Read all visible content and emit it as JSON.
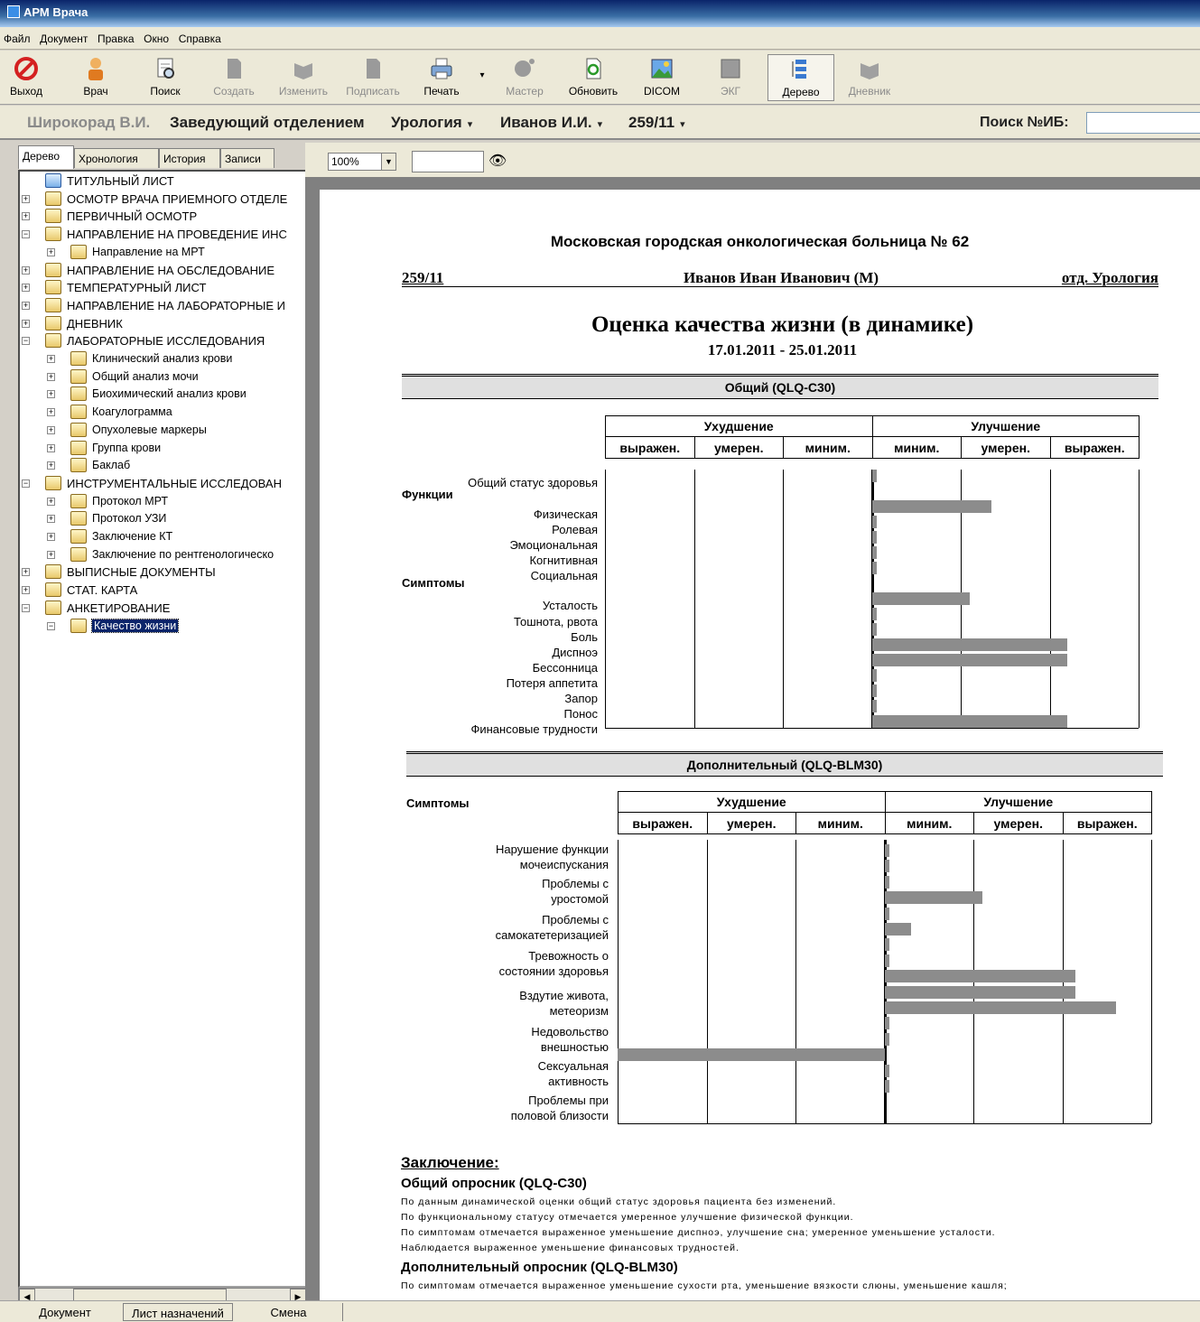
{
  "window": {
    "title": "АРМ Врача"
  },
  "menu": [
    "Файл",
    "Документ",
    "Правка",
    "Окно",
    "Справка"
  ],
  "toolbar": {
    "exit": "Выход",
    "doctor": "Врач",
    "search": "Поиск",
    "create": "Создать",
    "edit": "Изменить",
    "sign": "Подписать",
    "print": "Печать",
    "wizard": "Мастер",
    "refresh": "Обновить",
    "dicom": "DICOM",
    "ecg": "ЭКГ",
    "tree": "Дерево",
    "diary": "Дневник"
  },
  "context": {
    "doctor": "Широкорад В.И.",
    "position": "Заведующий отделением",
    "department": "Урология",
    "patient": "Иванов И.И.",
    "case": "259/11",
    "search_label": "Поиск №ИБ:",
    "search_value": ""
  },
  "left_tabs": [
    "Дерево",
    "Хронология",
    "История",
    "Записи"
  ],
  "tree": [
    {
      "label": "ТИТУЛЬНЫЙ ЛИСТ",
      "level": 0,
      "toggle": ""
    },
    {
      "label": "ОСМОТР ВРАЧА ПРИЕМНОГО ОТДЕЛЕ",
      "level": 0,
      "toggle": "+"
    },
    {
      "label": "ПЕРВИЧНЫЙ ОСМОТР",
      "level": 0,
      "toggle": "+"
    },
    {
      "label": "НАПРАВЛЕНИЕ НА ПРОВЕДЕНИЕ ИНС",
      "level": 0,
      "toggle": "−"
    },
    {
      "label": "Направление на МРТ",
      "level": 1,
      "toggle": "+"
    },
    {
      "label": "НАПРАВЛЕНИЕ НА ОБСЛЕДОВАНИЕ",
      "level": 0,
      "toggle": "+"
    },
    {
      "label": "ТЕМПЕРАТУРНЫЙ ЛИСТ",
      "level": 0,
      "toggle": "+"
    },
    {
      "label": "НАПРАВЛЕНИЕ НА ЛАБОРАТОРНЫЕ И",
      "level": 0,
      "toggle": "+"
    },
    {
      "label": "ДНЕВНИК",
      "level": 0,
      "toggle": "+"
    },
    {
      "label": "ЛАБОРАТОРНЫЕ ИССЛЕДОВАНИЯ",
      "level": 0,
      "toggle": "−"
    },
    {
      "label": "Клинический анализ крови",
      "level": 1,
      "toggle": "+"
    },
    {
      "label": "Общий анализ мочи",
      "level": 1,
      "toggle": "+"
    },
    {
      "label": "Биохимический анализ крови",
      "level": 1,
      "toggle": "+"
    },
    {
      "label": "Коагулограмма",
      "level": 1,
      "toggle": "+"
    },
    {
      "label": "Опухолевые маркеры",
      "level": 1,
      "toggle": "+"
    },
    {
      "label": "Группа крови",
      "level": 1,
      "toggle": "+"
    },
    {
      "label": "Баклаб",
      "level": 1,
      "toggle": "+"
    },
    {
      "label": "ИНСТРУМЕНТАЛЬНЫЕ ИССЛЕДОВАН",
      "level": 0,
      "toggle": "−"
    },
    {
      "label": "Протокол МРТ",
      "level": 1,
      "toggle": "+"
    },
    {
      "label": "Протокол УЗИ",
      "level": 1,
      "toggle": "+"
    },
    {
      "label": "Заключение КТ",
      "level": 1,
      "toggle": "+"
    },
    {
      "label": "Заключение по рентгенологическо",
      "level": 1,
      "toggle": "+"
    },
    {
      "label": "ВЫПИСНЫЕ ДОКУМЕНТЫ",
      "level": 0,
      "toggle": "+"
    },
    {
      "label": "СТАТ. КАРТА",
      "level": 0,
      "toggle": "+"
    },
    {
      "label": "АНКЕТИРОВАНИЕ",
      "level": 0,
      "toggle": "−"
    },
    {
      "label": "Качество жизни",
      "level": 1,
      "toggle": "−",
      "selected": true
    }
  ],
  "viewer": {
    "zoom": "100%",
    "find_value": ""
  },
  "report": {
    "hospital": "Московская городская онкологическая больница №     62",
    "case_no": "259/11",
    "patient_full": "Иванов Иван Иванович (М)",
    "department": "отд. Урология",
    "title": "Оценка качества жизни (в динамике)",
    "dates": "17.01.2011 - 25.01.2011",
    "worse": "Ухудшение",
    "better": "Улучшение",
    "cols_worse": [
      "выражен.",
      "умерен.",
      "миним."
    ],
    "cols_better": [
      "миним.",
      "умерен.",
      "выражен."
    ],
    "sec1": {
      "title": "Общий (QLQ-C30)",
      "groups": [
        "Функции",
        "Симптомы"
      ],
      "rows": [
        "Общий статус здоровья",
        "Физическая",
        "Ролевая",
        "Эмоциональная",
        "Когнитивная",
        "Социальная",
        "Усталость",
        "Тошнота, рвота",
        "Боль",
        "Диспноэ",
        "Бессонница",
        "Потеря аппетита",
        "Запор",
        "Понос",
        "Финансовые трудности"
      ]
    },
    "sec2": {
      "title": "Дополнительный (QLQ-BLM30)",
      "group": "Симптомы",
      "rows": [
        "Нарушение функции\nмочеиспускания",
        "Проблемы с\nуростомой",
        "Проблемы с\nсамокатетеризацией",
        "Тревожность о\nсостоянии здоровья",
        "Вздутие живота,\nметеоризм",
        "Недовольство\nвнешностью",
        "Сексуальная\nактивность",
        "Проблемы при\nполовой близости"
      ]
    },
    "conclusion": {
      "title": "Заключение:",
      "general_title": "Общий опросник (QLQ-C30)",
      "lines": [
        "По данным динамической оценки общий статус здоровья пациента без изменений.",
        "По функциональному статусу отмечается умеренное улучшение физической функции.",
        "По симптомам отмечается выраженное уменьшение диспноэ, улучшение сна; умеренное уменьшение усталости.",
        "Наблюдается выраженное уменьшение финансовых трудностей."
      ],
      "extra_title": "Дополнительный опросник (QLQ-BLM30)",
      "extra_line": "По симптомам отмечается выраженное уменьшение сухости рта, уменьшение вязкости слюны, уменьшение кашля;"
    }
  },
  "chart_data": [
    {
      "type": "bar",
      "title": "Общий (QLQ-C30)",
      "scale_note": "change scale: negative = Ухудшение (выражен./умерен./миним.), positive = Улучшение (миним./умерен./выражен.); each column = 1 unit",
      "xlim": [
        -3,
        3
      ],
      "categories": [
        "Общий статус здоровья",
        "Физическая",
        "Ролевая",
        "Эмоциональная",
        "Когнитивная",
        "Социальная",
        "Усталость",
        "Тошнота, рвота",
        "Боль",
        "Диспноэ",
        "Бессонница",
        "Потеря аппетита",
        "Запор",
        "Понос",
        "Финансовые трудности"
      ],
      "values": [
        0.05,
        1.35,
        0.05,
        0.05,
        0.05,
        0.05,
        1.1,
        0.05,
        0.05,
        2.2,
        2.2,
        0.05,
        0.05,
        0.05,
        2.2
      ]
    },
    {
      "type": "bar",
      "title": "Дополнительный (QLQ-BLM30)",
      "xlim": [
        -3,
        3
      ],
      "rows_per_item": 2,
      "values": [
        0.05,
        0.05,
        0.05,
        1.1,
        0.05,
        0.3,
        0.05,
        0.05,
        2.15,
        2.15,
        2.6,
        0.05,
        0.05,
        -3.0,
        0.05,
        0.05
      ]
    }
  ],
  "statusbar": [
    "Документ",
    "Лист назначений",
    "Смена"
  ]
}
